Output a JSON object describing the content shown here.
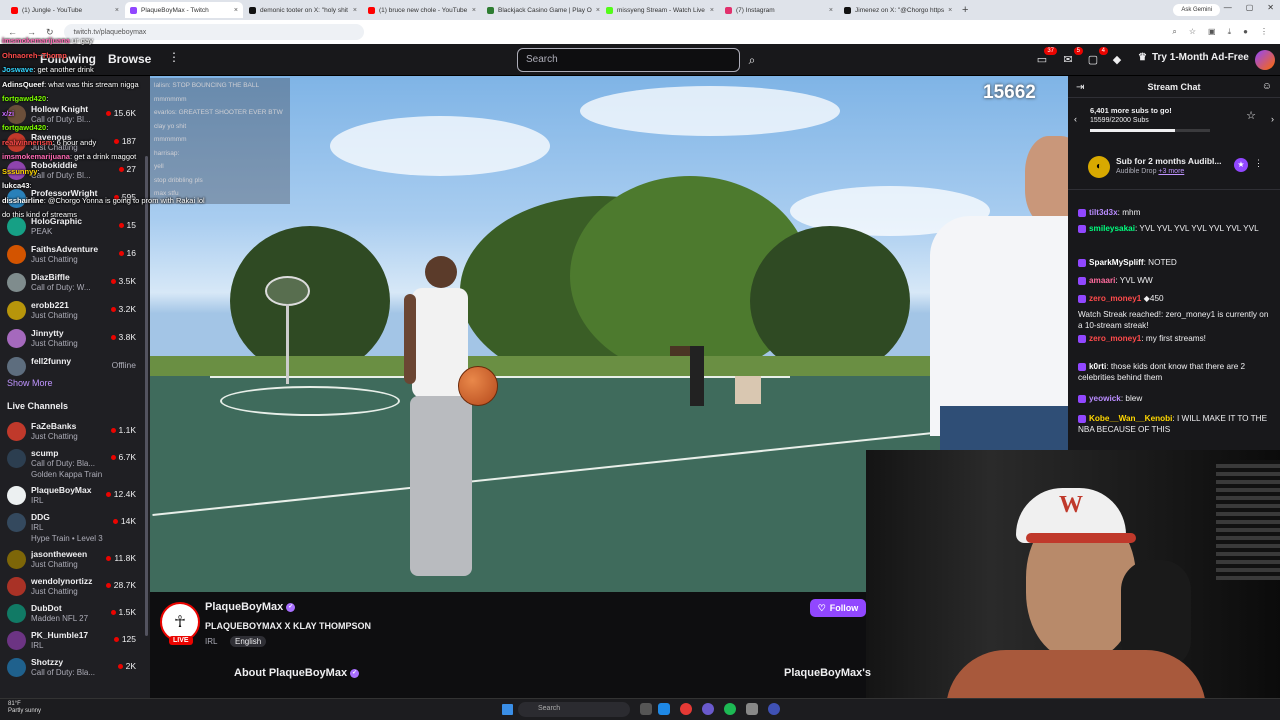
{
  "browser": {
    "tabs": [
      {
        "label": "(1) Jungle - YouTube",
        "color": "#ff0000",
        "active": false
      },
      {
        "label": "PlaqueBoyMax - Twitch",
        "color": "#9147ff",
        "active": true
      },
      {
        "label": "demonic tooter on X: \"holy shit",
        "color": "#111111",
        "active": false
      },
      {
        "label": "(1) bruce new chole - YouTube",
        "color": "#ff0000",
        "active": false
      },
      {
        "label": "Blackjack Casino Game | Play O",
        "color": "#2e7d32",
        "active": false
      },
      {
        "label": "missyeng Stream - Watch Live",
        "color": "#53fc18",
        "active": false
      },
      {
        "label": "(7) Instagram",
        "color": "#e1306c",
        "active": false
      },
      {
        "label": "Jimenez on X: \"@Chorgo https",
        "color": "#111111",
        "active": false
      }
    ],
    "new_tab": "+",
    "gemini": "Ask Gemini",
    "url": "twitch.tv/plaqueboymax",
    "window_controls": [
      "—",
      "▢",
      "✕"
    ]
  },
  "nav": {
    "following": "Following",
    "browse": "Browse",
    "more": "⋮",
    "search_placeholder": "Search",
    "badges": {
      "inbox": "37",
      "whispers": "5",
      "notifications": "4"
    },
    "ad_free": "Try 1-Month Ad-Free"
  },
  "overlay_chat": [
    {
      "user": "imsmokemarijuana",
      "text": " ur gay",
      "color": "#ff69b4"
    },
    {
      "user": "Ohnaoreh~Thomp",
      "text": "",
      "color": "#ff4b4b"
    },
    {
      "user": "Joswave",
      "text": ": get another drink",
      "color": "#33d6ff"
    },
    {
      "user": "AdinsQueef",
      "text": ": what was this stream nigga",
      "color": "#ffffff"
    },
    {
      "user": "fortgawd420",
      "text": ":",
      "color": "#7cfc00"
    },
    {
      "user": "x/zi",
      "text": "",
      "color": "#c86bff"
    },
    {
      "user": "fortgawd420",
      "text": ":",
      "color": "#7cfc00"
    },
    {
      "user": "realwinnerism",
      "text": ": 6 hour andy",
      "color": "#ff4b4b"
    },
    {
      "user": "imsmokemarijuana",
      "text": ": get a drink maggot",
      "color": "#ff69b4"
    },
    {
      "user": "Sssunnyy",
      "text": ":",
      "color": "#ffd700"
    },
    {
      "user": "lukca43",
      "text": ":",
      "color": "#ffffff"
    },
    {
      "user": "disshairline",
      "text": ": @Chorgo Yonna is going to prom with Rakai lol",
      "color": "#ffffff"
    },
    {
      "user": "",
      "text": "do this kind of streams",
      "color": "#ffffff"
    }
  ],
  "faded_chat": [
    "lalisn: STOP BOUNCING THE BALL",
    "mmmmmm",
    "evarlos: GREATEST SHOOTER EVER BTW",
    "clay yo shit",
    "mmmmmm",
    "harrisap:",
    "yell",
    "stop dribbling pls",
    "max stfu"
  ],
  "sidebar": {
    "channels": [
      {
        "name": "Hollow Knight",
        "game": "Call of Duty: Bl...",
        "viewers": "15.6K",
        "color": "#6b4f3a"
      },
      {
        "name": "Ravenous",
        "game": "Just Chatting",
        "viewers": "187",
        "color": "#c0392b"
      },
      {
        "name": "Robokiddie",
        "game": "Call of Duty: Bl...",
        "viewers": "27",
        "color": "#8e44ad"
      },
      {
        "name": "ProfessorWright",
        "game": "",
        "viewers": "595",
        "color": "#2980b9"
      },
      {
        "name": "HoloGraphic",
        "game": "PEAK",
        "viewers": "15",
        "color": "#16a085"
      },
      {
        "name": "FaithsAdventure",
        "game": "Just Chatting",
        "viewers": "16",
        "color": "#d35400"
      },
      {
        "name": "DiazBiffle",
        "game": "Call of Duty: W...",
        "viewers": "3.5K",
        "color": "#7f8c8d"
      },
      {
        "name": "erobb221",
        "game": "Just Chatting",
        "viewers": "3.2K",
        "color": "#b7950b"
      },
      {
        "name": "Jinnytty",
        "game": "Just Chatting",
        "viewers": "3.8K",
        "color": "#a569bd"
      },
      {
        "name": "fell2funny",
        "game": "",
        "viewers": "Offline",
        "color": "#5d6d7e"
      }
    ],
    "show_more": "Show More",
    "live_channels_title": "Live Channels",
    "live": [
      {
        "name": "FaZeBanks",
        "game": "Just Chatting",
        "viewers": "1.1K",
        "color": "#c0392b",
        "sub": ""
      },
      {
        "name": "scump",
        "game": "Call of Duty: Bla...",
        "viewers": "6.7K",
        "color": "#2c3e50",
        "sub": "Golden Kappa Train"
      },
      {
        "name": "PlaqueBoyMax",
        "game": "IRL",
        "viewers": "12.4K",
        "color": "#ecf0f1",
        "sub": ""
      },
      {
        "name": "DDG",
        "game": "IRL",
        "viewers": "14K",
        "color": "#34495e",
        "sub": "Hype Train • Level 3"
      },
      {
        "name": "jasontheween",
        "game": "Just Chatting",
        "viewers": "11.8K",
        "color": "#7d6608",
        "sub": ""
      },
      {
        "name": "wendolynortizz",
        "game": "Just Chatting",
        "viewers": "28.7K",
        "color": "#a93226",
        "sub": ""
      },
      {
        "name": "DubDot",
        "game": "Madden NFL 27",
        "viewers": "1.5K",
        "color": "#117a65",
        "sub": ""
      },
      {
        "name": "PK_Humble17",
        "game": "IRL",
        "viewers": "125",
        "color": "#6c3483",
        "sub": ""
      },
      {
        "name": "Shotzzy",
        "game": "Call of Duty: Bla...",
        "viewers": "2K",
        "color": "#1f618d",
        "sub": ""
      }
    ]
  },
  "video": {
    "viewer_count": "15662"
  },
  "stream": {
    "name": "PlaqueBoyMax",
    "title": "PLAQUEBOYMAX X KLAY THOMPSON",
    "live": "LIVE",
    "category": "IRL",
    "language": "English",
    "follow": "Follow",
    "about": "About PlaqueBoyMax",
    "side_label": "PlaqueBoyMax's"
  },
  "chat": {
    "title": "Stream Chat",
    "goal_line1": "6,401 more subs to go!",
    "goal_line2": "15599/22000 Subs",
    "goal_progress": 0.709,
    "drop_title": "Sub for 2 months Audibl...",
    "drop_sub": "Audible Drop",
    "drop_more": "+3 more",
    "messages": [
      {
        "user": "tilt3d3x",
        "text": ": mhm",
        "color": "#b98cff"
      },
      {
        "user": "smileysakai",
        "text": ": YVL YVL YVL YVL YVL YVL YVL",
        "color": "#00ff7f"
      },
      {
        "user": "SparkMySpliff",
        "text": ": NOTED",
        "color": "#ffffff"
      },
      {
        "user": "amaari",
        "text": ": YVL WW",
        "color": "#ff6b9d"
      },
      {
        "user": "zero_money1",
        "text": " ◆450",
        "color": "#ff4b4b"
      },
      {
        "user": "",
        "text": "Watch Streak reached!: zero_money1 is currently on a 10-stream streak!",
        "color": "#ffffff"
      },
      {
        "user": "zero_money1",
        "text": ": my first streams!",
        "color": "#ff4b4b"
      },
      {
        "user": "k0rti",
        "text": ": those kids dont know that there are 2 celebrities behind them",
        "color": "#ffffff"
      },
      {
        "user": "yeowick",
        "text": ": blew",
        "color": "#b98cff"
      },
      {
        "user": "Kobe__Wan__Kenobi",
        "text": ": I WILL MAKE IT TO THE NBA BECAUSE OF THIS",
        "color": "#ffd700"
      }
    ]
  },
  "taskbar": {
    "weather_temp": "81°F",
    "weather_desc": "Partly sunny",
    "search": "Search"
  }
}
